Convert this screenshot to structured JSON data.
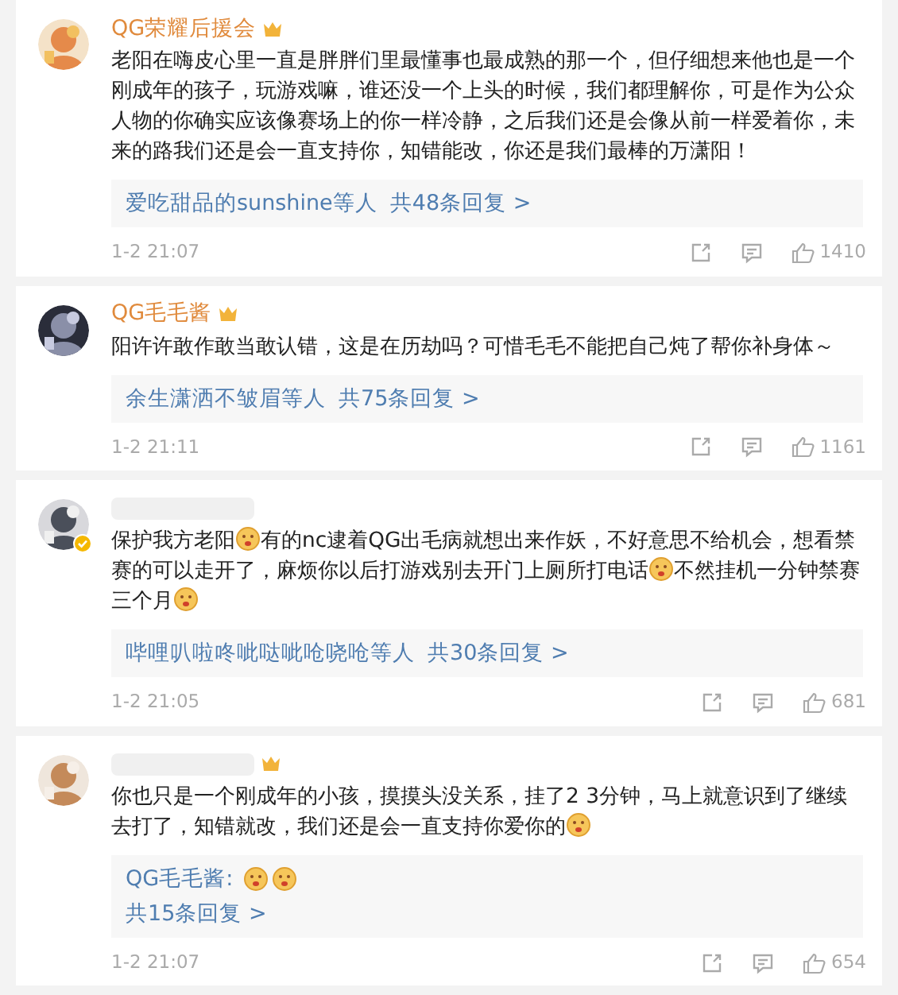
{
  "comments": [
    {
      "name": "QG荣耀后援会",
      "name_badge": true,
      "verified": false,
      "avatar": {
        "kind": "picture"
      },
      "body": [
        {
          "kind": "text",
          "text": "老阳在嗨皮心里一直是胖胖们里最懂事也最成熟的那一个，但仔细想来他也是一个刚成年的孩子，玩游戏嘛，谁还没一个上头的时候，我们都理解你，可是作为公众人物的你确实应该像赛场上的你一样冷静，之后我们还是会像从前一样爱着你，未来的路我们还是会一直支持你，知错能改，你还是我们最棒的万潇阳！"
        }
      ],
      "replies": {
        "preview_name": "爱吃甜品的sunshine等人",
        "count": "共48条回复 >"
      },
      "time": "1-2 21:07",
      "likes": "1410"
    },
    {
      "name": "QG毛毛酱",
      "name_badge": true,
      "verified": false,
      "avatar": {
        "kind": "picture"
      },
      "body": [
        {
          "kind": "text",
          "text": "阳许许敢作敢当敢认错，这是在历劫吗？可惜毛毛不能把自己炖了帮你补身体～"
        }
      ],
      "replies": {
        "preview_name": "余生潇洒不皱眉等人",
        "count": "共75条回复 >"
      },
      "time": "1-2 21:11",
      "likes": "1161"
    },
    {
      "name_badge": false,
      "verified": true,
      "avatar": {
        "kind": "picture"
      },
      "body": [
        {
          "kind": "text",
          "text": "保护我方老阳"
        },
        {
          "kind": "emoji"
        },
        {
          "kind": "text",
          "text": "有的nc逮着QG出毛病就想出来作妖，不好意思不给机会，想看禁赛的可以走开了，麻烦你以后打游戏别去开门上厕所打电话"
        },
        {
          "kind": "emoji"
        },
        {
          "kind": "text",
          "text": "不然挂机一分钟禁赛三个月"
        },
        {
          "kind": "emoji"
        }
      ],
      "replies": {
        "preview_name": "哔哩叭啦咚呲哒呲呛哓呛等人",
        "count": "共30条回复 >"
      },
      "time": "1-2 21:05",
      "likes": "681"
    },
    {
      "name_badge": true,
      "verified": false,
      "avatar": {
        "kind": "picture"
      },
      "body": [
        {
          "kind": "text",
          "text": "你也只是一个刚成年的小孩，摸摸头没关系，挂了2 3分钟，马上就意识到了继续去打了，知错就改，我们还是会一直支持你爱你的"
        },
        {
          "kind": "emoji"
        }
      ],
      "replies": {
        "reply_author": "QG毛毛酱:",
        "reply_body": [
          {
            "kind": "emoji"
          },
          {
            "kind": "emoji"
          }
        ],
        "count": "共15条回复 >"
      },
      "time": "1-2 21:07",
      "likes": "654"
    }
  ]
}
